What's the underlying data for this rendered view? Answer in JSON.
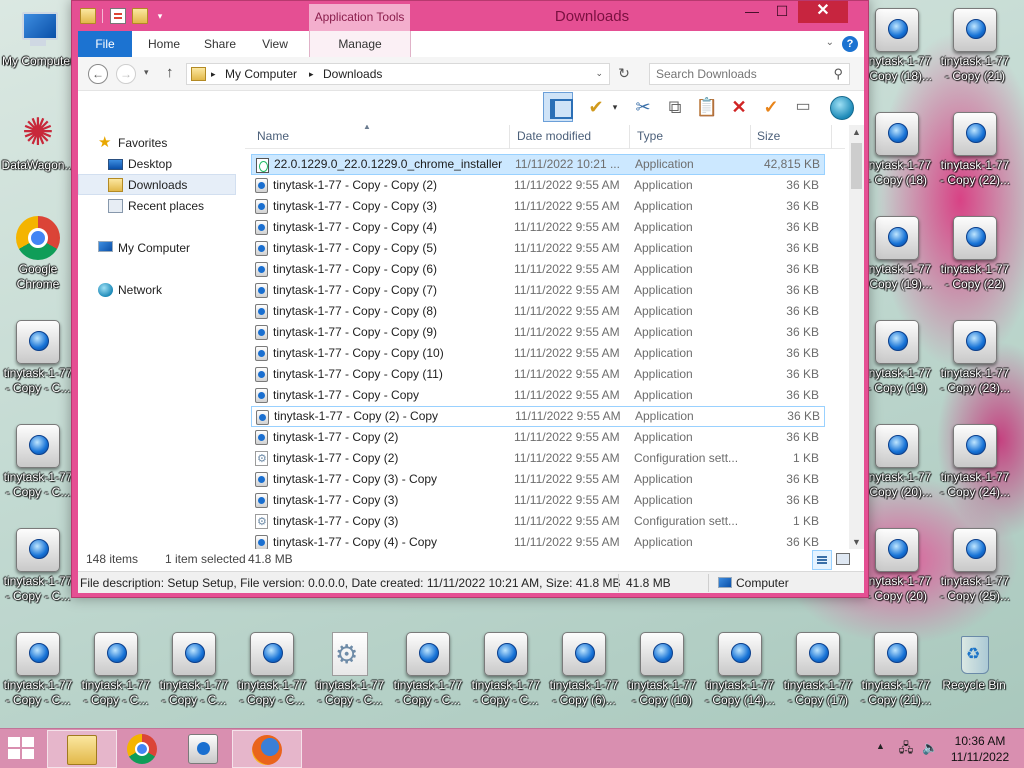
{
  "desktop": {
    "left_icons": [
      {
        "label": "My Computer",
        "kind": "pc"
      },
      {
        "label": "DataWagon...",
        "kind": "datawagon"
      },
      {
        "label": "Google\nChrome",
        "kind": "chrome"
      },
      {
        "label": "tinytask-1-77\n- Copy - C...",
        "kind": "tinytask"
      },
      {
        "label": "tinytask-1-77\n- Copy - C...",
        "kind": "tinytask"
      },
      {
        "label": "tinytask-1-77\n- Copy - C...",
        "kind": "tinytask"
      }
    ],
    "right_col1": [
      {
        "label": "tinytask-1-77\n- Copy (18)...",
        "kind": "tinytask"
      },
      {
        "label": "tinytask-1-77\n- Copy (18)",
        "kind": "tinytask"
      },
      {
        "label": "tinytask-1-77\n- Copy (19)...",
        "kind": "tinytask"
      },
      {
        "label": "tinytask-1-77\n- Copy (19)",
        "kind": "tinytask"
      },
      {
        "label": "tinytask-1-77\n- Copy (20)...",
        "kind": "tinytask"
      },
      {
        "label": "tinytask-1-77\n- Copy (20)",
        "kind": "tinytask"
      }
    ],
    "right_col2": [
      {
        "label": "tinytask-1-77\n- Copy (21)",
        "kind": "tinytask"
      },
      {
        "label": "tinytask-1-77\n- Copy (22)...",
        "kind": "tinytask"
      },
      {
        "label": "tinytask-1-77\n- Copy (22)",
        "kind": "tinytask"
      },
      {
        "label": "tinytask-1-77\n- Copy (23)...",
        "kind": "tinytask"
      },
      {
        "label": "tinytask-1-77\n- Copy (24)...",
        "kind": "tinytask"
      },
      {
        "label": "tinytask-1-77\n- Copy (25)...",
        "kind": "tinytask"
      }
    ],
    "bottom_row": [
      {
        "label": "tinytask-1-77\n- Copy - C...",
        "kind": "tinytask"
      },
      {
        "label": "tinytask-1-77\n- Copy - C...",
        "kind": "tinytask"
      },
      {
        "label": "tinytask-1-77\n- Copy - C...",
        "kind": "tinytask"
      },
      {
        "label": "tinytask-1-77\n- Copy - C...",
        "kind": "tinytask"
      },
      {
        "label": "tinytask-1-77\n- Copy - C...",
        "kind": "config"
      },
      {
        "label": "tinytask-1-77\n- Copy - C...",
        "kind": "tinytask"
      },
      {
        "label": "tinytask-1-77\n- Copy - C...",
        "kind": "tinytask"
      },
      {
        "label": "tinytask-1-77\n- Copy (6)...",
        "kind": "tinytask"
      },
      {
        "label": "tinytask-1-77\n- Copy (10)",
        "kind": "tinytask"
      },
      {
        "label": "tinytask-1-77\n- Copy (14)...",
        "kind": "tinytask"
      },
      {
        "label": "tinytask-1-77\n- Copy (17)",
        "kind": "tinytask"
      },
      {
        "label": "tinytask-1-77\n- Copy (21)...",
        "kind": "tinytask"
      },
      {
        "label": "Recycle Bin",
        "kind": "recycle"
      }
    ]
  },
  "window": {
    "title": "Downloads",
    "context_tab": "Application Tools",
    "controls": {
      "minimize": "—",
      "maximize": "☐",
      "close": "✕"
    }
  },
  "ribbon": {
    "tabs": {
      "file": "File",
      "home": "Home",
      "share": "Share",
      "view": "View",
      "manage": "Manage"
    },
    "help": "?"
  },
  "address": {
    "segments": [
      "My Computer",
      "Downloads"
    ],
    "separator": "▸",
    "search_placeholder": "Search Downloads"
  },
  "nav": {
    "favorites": "Favorites",
    "desktop": "Desktop",
    "downloads": "Downloads",
    "recent": "Recent places",
    "computer": "My Computer",
    "network": "Network"
  },
  "columns": {
    "name": "Name",
    "date": "Date modified",
    "type": "Type",
    "size": "Size"
  },
  "files": [
    {
      "name": "22.0.1229.0_22.0.1229.0_chrome_installer",
      "date": "11/11/2022 10:21 ...",
      "type": "Application",
      "size": "42,815 KB",
      "icon": "installer",
      "state": "selected"
    },
    {
      "name": "tinytask-1-77 - Copy - Copy (2)",
      "date": "11/11/2022 9:55 AM",
      "type": "Application",
      "size": "36 KB",
      "icon": "app",
      "state": ""
    },
    {
      "name": "tinytask-1-77 - Copy - Copy (3)",
      "date": "11/11/2022 9:55 AM",
      "type": "Application",
      "size": "36 KB",
      "icon": "app",
      "state": ""
    },
    {
      "name": "tinytask-1-77 - Copy - Copy (4)",
      "date": "11/11/2022 9:55 AM",
      "type": "Application",
      "size": "36 KB",
      "icon": "app",
      "state": ""
    },
    {
      "name": "tinytask-1-77 - Copy - Copy (5)",
      "date": "11/11/2022 9:55 AM",
      "type": "Application",
      "size": "36 KB",
      "icon": "app",
      "state": ""
    },
    {
      "name": "tinytask-1-77 - Copy - Copy (6)",
      "date": "11/11/2022 9:55 AM",
      "type": "Application",
      "size": "36 KB",
      "icon": "app",
      "state": ""
    },
    {
      "name": "tinytask-1-77 - Copy - Copy (7)",
      "date": "11/11/2022 9:55 AM",
      "type": "Application",
      "size": "36 KB",
      "icon": "app",
      "state": ""
    },
    {
      "name": "tinytask-1-77 - Copy - Copy (8)",
      "date": "11/11/2022 9:55 AM",
      "type": "Application",
      "size": "36 KB",
      "icon": "app",
      "state": ""
    },
    {
      "name": "tinytask-1-77 - Copy - Copy (9)",
      "date": "11/11/2022 9:55 AM",
      "type": "Application",
      "size": "36 KB",
      "icon": "app",
      "state": ""
    },
    {
      "name": "tinytask-1-77 - Copy - Copy (10)",
      "date": "11/11/2022 9:55 AM",
      "type": "Application",
      "size": "36 KB",
      "icon": "app",
      "state": ""
    },
    {
      "name": "tinytask-1-77 - Copy - Copy (11)",
      "date": "11/11/2022 9:55 AM",
      "type": "Application",
      "size": "36 KB",
      "icon": "app",
      "state": ""
    },
    {
      "name": "tinytask-1-77 - Copy - Copy",
      "date": "11/11/2022 9:55 AM",
      "type": "Application",
      "size": "36 KB",
      "icon": "app",
      "state": ""
    },
    {
      "name": "tinytask-1-77 - Copy (2) - Copy",
      "date": "11/11/2022 9:55 AM",
      "type": "Application",
      "size": "36 KB",
      "icon": "app",
      "state": "focus"
    },
    {
      "name": "tinytask-1-77 - Copy (2)",
      "date": "11/11/2022 9:55 AM",
      "type": "Application",
      "size": "36 KB",
      "icon": "app",
      "state": ""
    },
    {
      "name": "tinytask-1-77 - Copy (2)",
      "date": "11/11/2022 9:55 AM",
      "type": "Configuration sett...",
      "size": "1 KB",
      "icon": "cfg",
      "state": ""
    },
    {
      "name": "tinytask-1-77 - Copy (3) - Copy",
      "date": "11/11/2022 9:55 AM",
      "type": "Application",
      "size": "36 KB",
      "icon": "app",
      "state": ""
    },
    {
      "name": "tinytask-1-77 - Copy (3)",
      "date": "11/11/2022 9:55 AM",
      "type": "Application",
      "size": "36 KB",
      "icon": "app",
      "state": ""
    },
    {
      "name": "tinytask-1-77 - Copy (3)",
      "date": "11/11/2022 9:55 AM",
      "type": "Configuration sett...",
      "size": "1 KB",
      "icon": "cfg",
      "state": ""
    },
    {
      "name": "tinytask-1-77 - Copy (4) - Copy",
      "date": "11/11/2022 9:55 AM",
      "type": "Application",
      "size": "36 KB",
      "icon": "app",
      "state": ""
    }
  ],
  "status": {
    "count": "148 items",
    "selected": "1 item selected",
    "size": "41.8 MB"
  },
  "details": {
    "description": "File description: Setup Setup, File version: 0.0.0.0, Date created: 11/11/2022 10:21 AM, Size: 41.8 MB",
    "size": "41.8 MB",
    "location": "Computer"
  },
  "taskbar": {
    "apps": [
      "explorer",
      "chrome",
      "tinytask",
      "firefox"
    ],
    "active_app": "explorer",
    "time": "10:36 AM",
    "date": "11/11/2022"
  },
  "colors": {
    "window_frame": "#e54f93",
    "file_tab": "#1c73d1",
    "selection": "#cce8ff",
    "taskbar": "#d98fb0"
  }
}
